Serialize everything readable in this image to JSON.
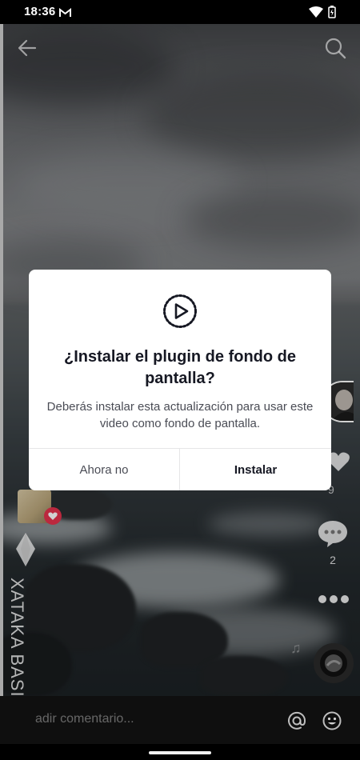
{
  "status_bar": {
    "time": "18:36",
    "icons": [
      "gmail-icon",
      "wifi-icon",
      "battery-charging-icon"
    ]
  },
  "top_bar": {
    "icons": [
      "back-arrow-icon",
      "search-icon"
    ]
  },
  "dialog": {
    "icon": "play-circle-dotted-icon",
    "title": "¿Instalar el plugin de fondo de pantalla?",
    "message": "Deberás instalar esta actualización para usar este video como fondo de pantalla.",
    "cancel_label": "Ahora no",
    "confirm_label": "Instalar"
  },
  "right_rail": {
    "like_count": "9",
    "comment_count": "2",
    "icons": [
      "creator-avatar",
      "heart-icon",
      "comment-icon",
      "more-icon",
      "music-disc-icon"
    ]
  },
  "watermark": {
    "text": "XATAKA BASICS"
  },
  "comment_bar": {
    "placeholder": "adir comentario...",
    "icons": [
      "at-mention-icon",
      "emoji-icon"
    ]
  },
  "colors": {
    "dialog_bg": "#ffffff",
    "title_text": "#161823",
    "body_text": "#4a4c55",
    "like_badge": "#e5314c"
  }
}
